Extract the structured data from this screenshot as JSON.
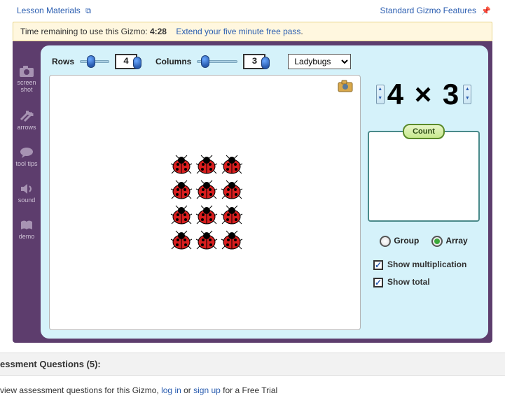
{
  "top": {
    "lesson_materials": "Lesson Materials",
    "standard_features": "Standard Gizmo Features"
  },
  "timer": {
    "prefix": "Time remaining to use this Gizmo: ",
    "time": "4:28",
    "extend": "Extend your five minute free pass"
  },
  "tools": {
    "screenshot": "screen shot",
    "arrows": "arrows",
    "tooltips": "tool tips",
    "sound": "sound",
    "demo": "demo"
  },
  "controls": {
    "rows_label": "Rows",
    "rows_value": "4",
    "cols_label": "Columns",
    "cols_value": "3",
    "dropdown_selected": "Ladybugs"
  },
  "expression": {
    "text": "4 × 3"
  },
  "buttons": {
    "count": "Count"
  },
  "modes": {
    "group": "Group",
    "array": "Array",
    "selected": "array"
  },
  "options": {
    "show_mult": "Show multiplication",
    "show_total": "Show total"
  },
  "assessment": {
    "header": "essment Questions (5):",
    "msg_prefix": " view assessment questions for this Gizmo, ",
    "login": "log in",
    "or": " or ",
    "signup": "sign up",
    "suffix": " for a Free Trial"
  },
  "chart_data": {
    "type": "table",
    "rows": 4,
    "columns": 3,
    "item_type": "Ladybugs",
    "expression": "4 × 3",
    "display_mode": "Array",
    "show_multiplication": true,
    "show_total": true
  }
}
